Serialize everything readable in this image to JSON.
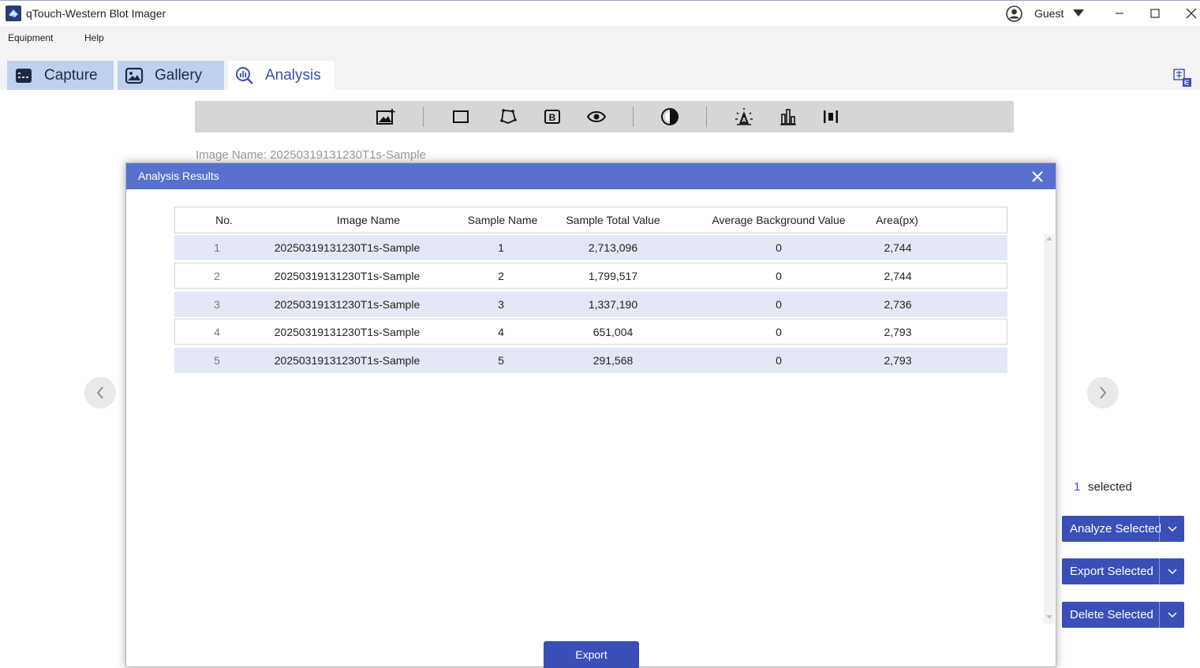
{
  "window": {
    "title": "qTouch-Western Blot Imager",
    "user": "Guest"
  },
  "menu": [
    "Equipment",
    "Help"
  ],
  "tabs": [
    {
      "label": "Capture",
      "active": false
    },
    {
      "label": "Gallery",
      "active": false
    },
    {
      "label": "Analysis",
      "active": true
    }
  ],
  "toolbar_icons": [
    "add-image-icon",
    "rectangle-select-icon",
    "polygon-select-icon",
    "background-icon",
    "visibility-icon",
    "contrast-icon",
    "auto-brightness-icon",
    "bar-chart-icon",
    "lane-icon"
  ],
  "image_name_label": "Image Name: 20250319131230T1s-Sample",
  "dialog": {
    "title": "Analysis Results",
    "columns": [
      "No.",
      "Image Name",
      "Sample Name",
      "Sample Total Value",
      "Average Background Value",
      "Area(px)"
    ],
    "rows": [
      [
        "1",
        "20250319131230T1s-Sample",
        "1",
        "2,713,096",
        "0",
        "2,744"
      ],
      [
        "2",
        "20250319131230T1s-Sample",
        "2",
        "1,799,517",
        "0",
        "2,744"
      ],
      [
        "3",
        "20250319131230T1s-Sample",
        "3",
        "1,337,190",
        "0",
        "2,736"
      ],
      [
        "4",
        "20250319131230T1s-Sample",
        "4",
        "651,004",
        "0",
        "2,793"
      ],
      [
        "5",
        "20250319131230T1s-Sample",
        "5",
        "291,568",
        "0",
        "2,793"
      ]
    ],
    "export_label": "Export"
  },
  "selection": {
    "count": "1",
    "label": "selected"
  },
  "actions": {
    "analyze": "Analyze Selected",
    "export": "Export Selected",
    "delete": "Delete Selected"
  },
  "colors": {
    "accent": "#3a4fb8",
    "dialog_header": "#5871ce",
    "row_shade": "#e4e8f6",
    "tab_inactive": "#bfd0ef"
  }
}
